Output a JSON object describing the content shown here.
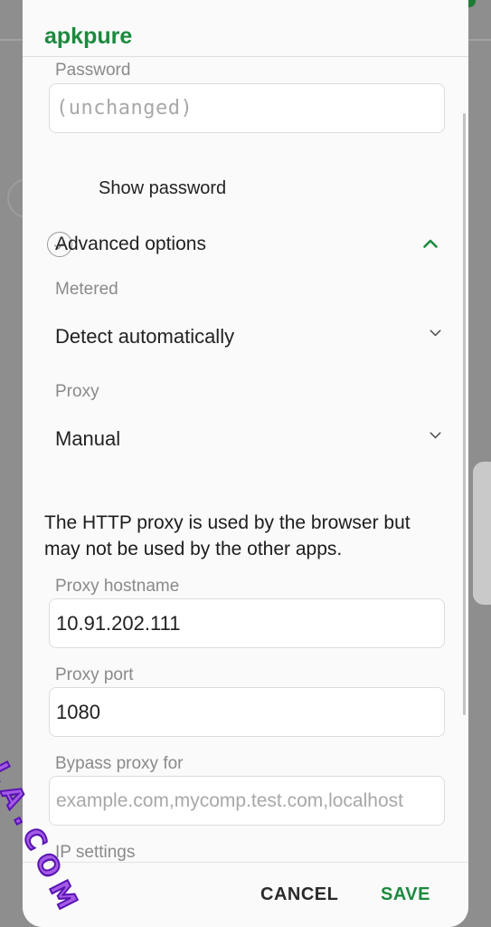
{
  "network": {
    "ssid": "apkpure"
  },
  "password": {
    "label": "Password",
    "placeholder": "(unchanged)"
  },
  "show_password": {
    "label": "Show password"
  },
  "advanced": {
    "label": "Advanced options"
  },
  "metered": {
    "label": "Metered",
    "value": "Detect automatically"
  },
  "proxy": {
    "label": "Proxy",
    "value": "Manual"
  },
  "proxy_note": "The HTTP proxy is used by the browser but may not be used by the other apps.",
  "proxy_hostname": {
    "label": "Proxy hostname",
    "value": "10.91.202.111"
  },
  "proxy_port": {
    "label": "Proxy port",
    "value": "1080"
  },
  "bypass": {
    "label": "Bypass proxy for",
    "placeholder": "example.com,mycomp.test.com,localhost"
  },
  "ip_settings": {
    "label": "IP settings"
  },
  "buttons": {
    "cancel": "CANCEL",
    "save": "SAVE"
  },
  "watermark": "ANDROIDTECHULLA.COM",
  "colors": {
    "accent": "#1b8a3e",
    "watermark": "#a45be6"
  },
  "icons": {
    "show_password": "checkmark-circle-icon",
    "advanced_toggle": "chevron-up-icon",
    "dropdown": "chevron-down-icon"
  }
}
